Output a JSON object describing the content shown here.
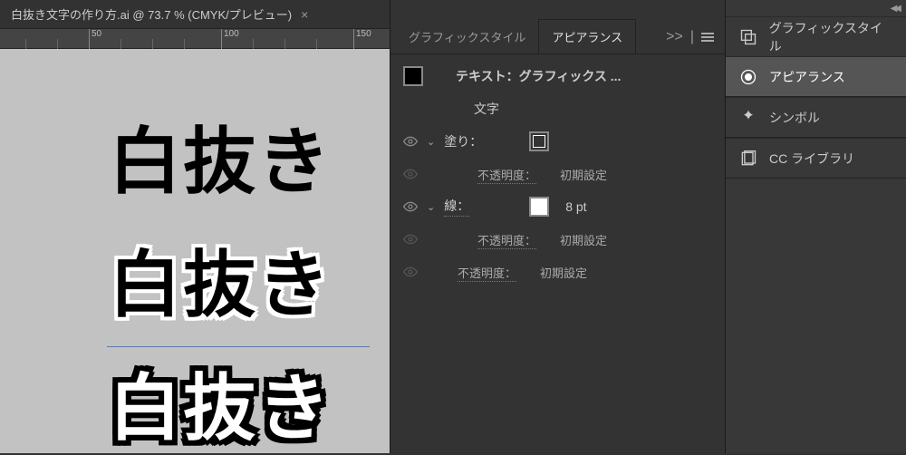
{
  "document": {
    "tab_title": "白抜き文字の作り方.ai @ 73.7 % (CMYK/プレビュー)",
    "ruler_marks": [
      "50",
      "100",
      "150"
    ]
  },
  "samples": {
    "text1": "白抜き",
    "text2": "白抜き",
    "text3": "白抜き"
  },
  "appearance": {
    "tab_graphic_styles": "グラフィックスタイル",
    "tab_appearance": "アピアランス",
    "more_label": ">>",
    "target_prefix": "テキスト：",
    "target_name": "グラフィックス ...",
    "moji": "文字",
    "fill_label": "塗り：",
    "opacity_label": "不透明度：",
    "opacity_value": "初期設定",
    "stroke_label": "線：",
    "stroke_weight": "8 pt"
  },
  "dock": {
    "graphic_styles": "グラフィックスタイル",
    "appearance": "アピアランス",
    "symbols": "シンボル",
    "cc_libraries": "CC ライブラリ"
  }
}
